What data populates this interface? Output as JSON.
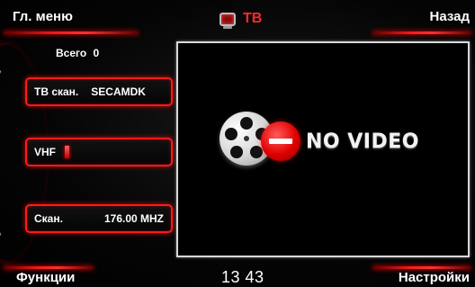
{
  "header": {
    "main_menu": "Гл. меню",
    "title": "ТВ",
    "back": "Назад"
  },
  "left_panel": {
    "total_label": "Всего",
    "total_count": "0",
    "scan_label": "ТВ скан.",
    "scan_value": "SECAMDK",
    "vhf_label": "VHF",
    "freq_label": "Скан.",
    "freq_value": "176.00 MHZ"
  },
  "video": {
    "status_text": "NO VIDEO"
  },
  "footer": {
    "functions": "Функции",
    "time": "13 43",
    "settings": "Настройки"
  },
  "colors": {
    "accent": "#ff1a1a",
    "title": "#ff2a2a",
    "background": "#000000"
  },
  "icons": {
    "title_icon": "tv-icon",
    "video_icon": "film-reel-icon",
    "stop_icon": "stop-icon"
  }
}
